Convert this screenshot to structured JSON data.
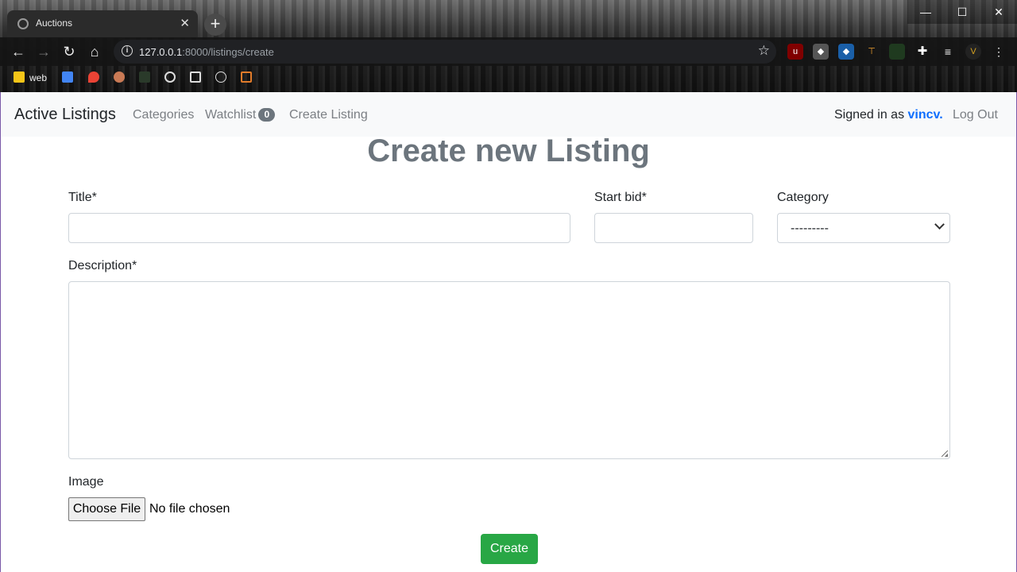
{
  "browser": {
    "tab_title": "Auctions",
    "tab_close": "✕",
    "new_tab": "+",
    "window_controls": {
      "minimize": "—",
      "maximize": "☐",
      "close": "✕"
    },
    "url_host": "127.0.0.1",
    "url_rest": ":8000/listings/create",
    "bookmarks": [
      {
        "label": "web",
        "icon": "folder-icon"
      }
    ]
  },
  "navbar": {
    "brand": "Active Listings",
    "links": [
      "Categories",
      "Watchlist",
      "Create Listing"
    ],
    "watchlist_count": "0",
    "signed_in_prefix": "Signed in as",
    "username": "vincv.",
    "logout": "Log Out"
  },
  "form": {
    "heading": "Create new Listing",
    "title_label": "Title*",
    "start_bid_label": "Start bid*",
    "category_label": "Category",
    "category_selected": "---------",
    "description_label": "Description*",
    "image_label": "Image",
    "file_button": "Choose File",
    "file_status": "No file chosen",
    "submit": "Create"
  },
  "colors": {
    "primary": "#0d6efd",
    "success": "#28a745",
    "muted": "#6c757d"
  }
}
